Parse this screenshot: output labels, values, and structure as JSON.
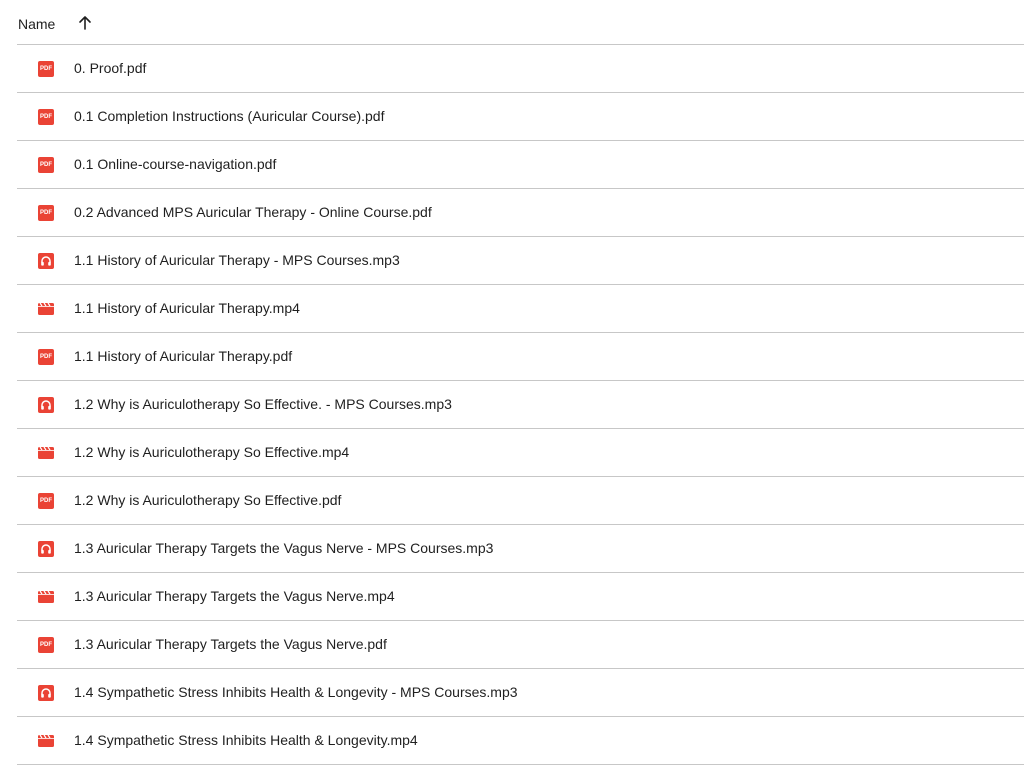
{
  "header": {
    "name_label": "Name",
    "sort_icon": "arrow-up-icon"
  },
  "colors": {
    "file_icon_red": "#ea4335",
    "divider": "#c7c7c7",
    "text": "#1f1f1f"
  },
  "files": [
    {
      "name": "0. Proof.pdf",
      "type": "pdf",
      "icon": "pdf-icon",
      "icon_text": "PDF"
    },
    {
      "name": "0.1 Completion Instructions (Auricular Course).pdf",
      "type": "pdf",
      "icon": "pdf-icon",
      "icon_text": "PDF"
    },
    {
      "name": "0.1 Online-course-navigation.pdf",
      "type": "pdf",
      "icon": "pdf-icon",
      "icon_text": "PDF"
    },
    {
      "name": "0.2 Advanced MPS Auricular Therapy - Online Course.pdf",
      "type": "pdf",
      "icon": "pdf-icon",
      "icon_text": "PDF"
    },
    {
      "name": "1.1 History of Auricular Therapy - MPS Courses.mp3",
      "type": "audio",
      "icon": "headphones-icon"
    },
    {
      "name": "1.1 History of Auricular Therapy.mp4",
      "type": "video",
      "icon": "video-clapper-icon"
    },
    {
      "name": "1.1 History of Auricular Therapy.pdf",
      "type": "pdf",
      "icon": "pdf-icon",
      "icon_text": "PDF"
    },
    {
      "name": "1.2 Why is Auriculotherapy So Effective. - MPS Courses.mp3",
      "type": "audio",
      "icon": "headphones-icon"
    },
    {
      "name": "1.2 Why is Auriculotherapy So Effective.mp4",
      "type": "video",
      "icon": "video-clapper-icon"
    },
    {
      "name": "1.2 Why is Auriculotherapy So Effective.pdf",
      "type": "pdf",
      "icon": "pdf-icon",
      "icon_text": "PDF"
    },
    {
      "name": "1.3 Auricular Therapy Targets the Vagus Nerve - MPS Courses.mp3",
      "type": "audio",
      "icon": "headphones-icon"
    },
    {
      "name": "1.3 Auricular Therapy Targets the Vagus Nerve.mp4",
      "type": "video",
      "icon": "video-clapper-icon"
    },
    {
      "name": "1.3 Auricular Therapy Targets the Vagus Nerve.pdf",
      "type": "pdf",
      "icon": "pdf-icon",
      "icon_text": "PDF"
    },
    {
      "name": "1.4 Sympathetic Stress Inhibits Health & Longevity - MPS Courses.mp3",
      "type": "audio",
      "icon": "headphones-icon"
    },
    {
      "name": "1.4 Sympathetic Stress Inhibits Health & Longevity.mp4",
      "type": "video",
      "icon": "video-clapper-icon"
    }
  ]
}
